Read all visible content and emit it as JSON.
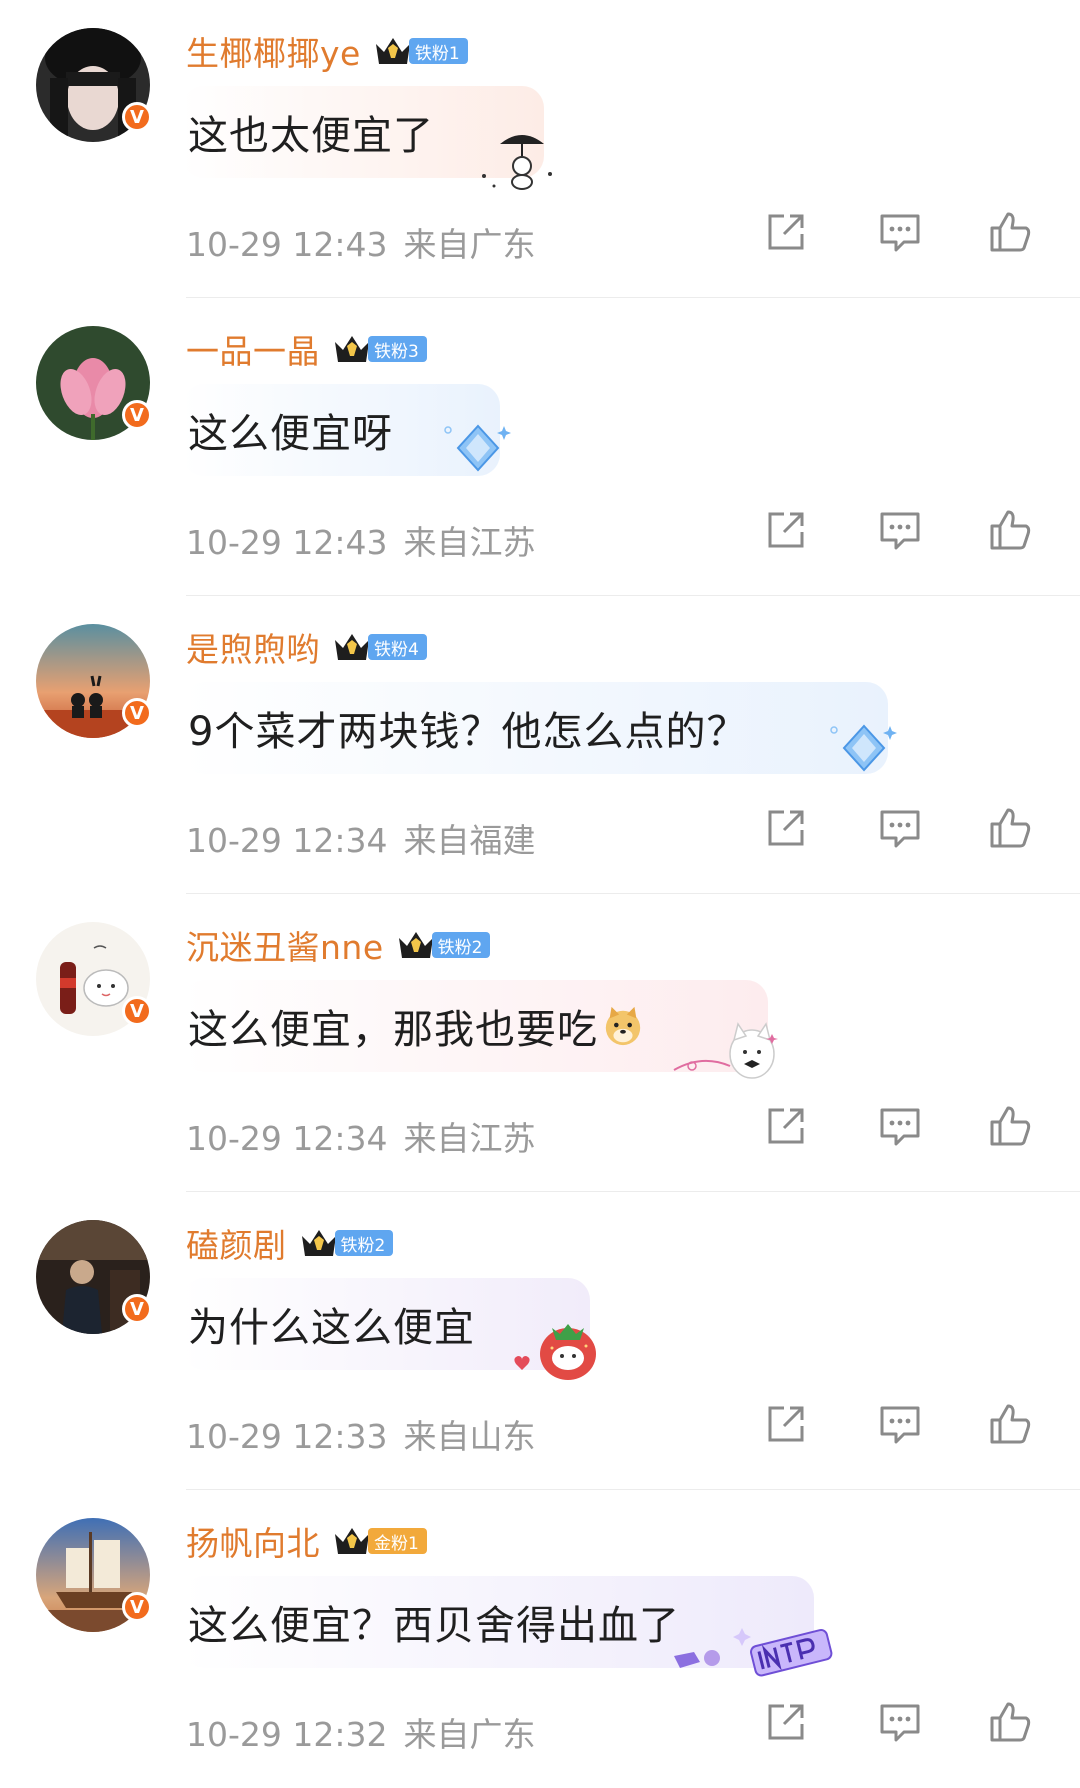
{
  "comments": [
    {
      "user": "生椰椰揶ye",
      "badge": "铁粉1",
      "text": "这也太便宜了",
      "date": "10-29 12:43",
      "location": "来自广东",
      "avatar": "woman-portrait",
      "bubble_color": "#fdeee8",
      "badge_color": "#5fa6f0",
      "bubble_deco": "umbrella-doll-sticker"
    },
    {
      "user": "一品一晶",
      "badge": "铁粉3",
      "text": "这么便宜呀",
      "date": "10-29 12:43",
      "location": "来自江苏",
      "avatar": "lotus-flower",
      "bubble_color": "#eaf3fd",
      "badge_color": "#5fa6f0",
      "bubble_deco": "blue-diamond-sticker"
    },
    {
      "user": "是煦煦哟",
      "badge": "铁粉4",
      "text": "9个菜才两块钱？他怎么点的？",
      "date": "10-29 12:34",
      "location": "来自福建",
      "avatar": "sunset-couple",
      "bubble_color": "#eaf3fd",
      "badge_color": "#5fa6f0",
      "bubble_deco": "blue-diamond-sticker"
    },
    {
      "user": "沉迷丑酱nne",
      "badge": "铁粉2",
      "text": "这么便宜，那我也要吃",
      "date": "10-29 12:34",
      "location": "来自江苏",
      "avatar": "cartoon-cola",
      "bubble_color": "#fdeeee",
      "badge_color": "#5fa6f0",
      "bubble_deco": "puppy-bow-sticker",
      "emoji": "doge-emoji"
    },
    {
      "user": "磕颜剧",
      "badge": "铁粉2",
      "text": "为什么这么便宜",
      "date": "10-29 12:33",
      "location": "来自山东",
      "avatar": "dark-figure",
      "bubble_color": "#f3eefb",
      "badge_color": "#5fa6f0",
      "bubble_deco": "strawberry-sticker"
    },
    {
      "user": "扬帆向北",
      "badge": "金粉1",
      "text": "这么便宜？西贝舍得出血了",
      "date": "10-29 12:32",
      "location": "来自广东",
      "avatar": "sailing-ship",
      "bubble_color": "#efecfb",
      "badge_color": "#f2a93b",
      "bubble_deco": "intp-sticker"
    }
  ],
  "icons": {
    "share": "share-icon",
    "reply": "comment-icon",
    "like": "thumbs-up-icon",
    "verified": "verified-v-icon",
    "crown": "crown-icon"
  },
  "verified_mark": "V"
}
